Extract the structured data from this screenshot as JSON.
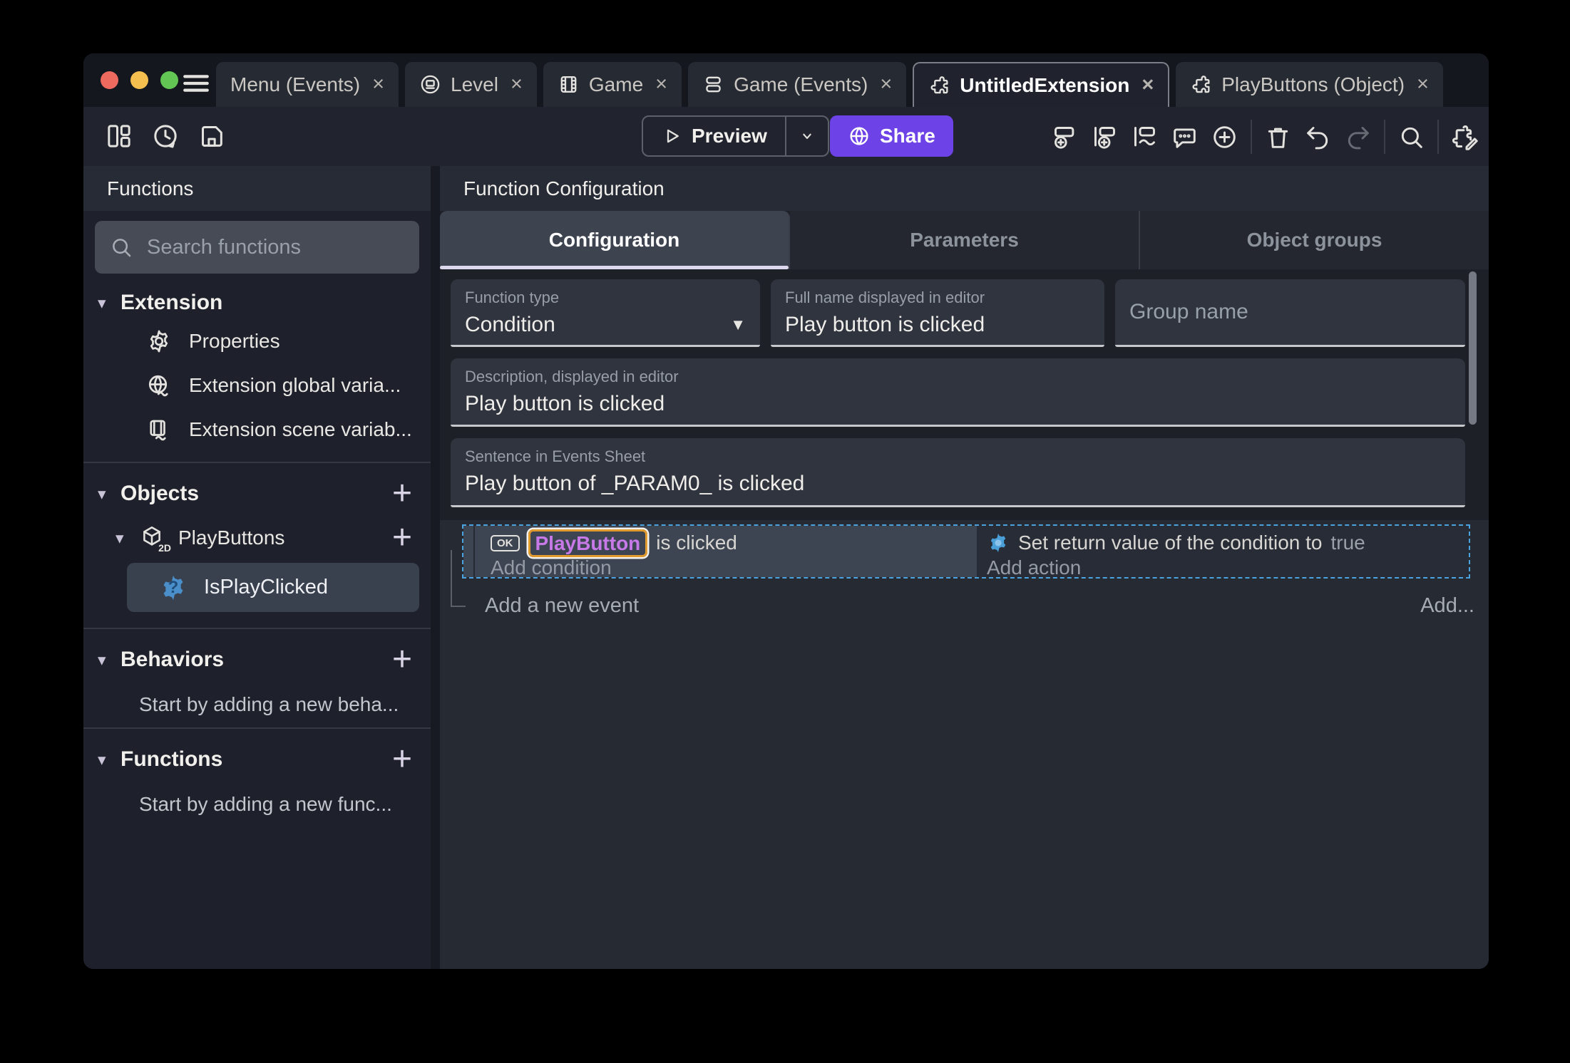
{
  "colors": {
    "accent_purple": "#6d43e8",
    "selection_blue": "#4aa3df",
    "object_text_purple": "#c879e8",
    "param_border_orange": "#e09a2d",
    "function_icon_blue": "#4b8fca",
    "traffic_red": "#ee6a5f",
    "traffic_yellow": "#f5bf4f",
    "traffic_green": "#62c554"
  },
  "tab_bar": {
    "close_glyph": "×",
    "tabs": [
      {
        "label": "Menu (Events)"
      },
      {
        "label": "Level"
      },
      {
        "label": "Game"
      },
      {
        "label": "Game (Events)"
      },
      {
        "label": "UntitledExtension"
      },
      {
        "label": "PlayButtons (Object)"
      }
    ]
  },
  "toolbar": {
    "preview_label": "Preview",
    "share_label": "Share"
  },
  "sidebar": {
    "title": "Functions",
    "search_placeholder": "Search functions",
    "extension_section": {
      "label": "Extension"
    },
    "extension_items": [
      {
        "label": "Properties"
      },
      {
        "label": "Extension global varia..."
      },
      {
        "label": "Extension scene variab..."
      }
    ],
    "objects_section": {
      "label": "Objects"
    },
    "playbuttons_item": {
      "label": "PlayButtons",
      "badge": "2D"
    },
    "selected_function": {
      "label": "IsPlayClicked",
      "glyph": "?"
    },
    "behaviors_section": {
      "label": "Behaviors",
      "empty_text": "Start by adding a new beha..."
    },
    "functions_section": {
      "label": "Functions",
      "empty_text": "Start by adding a new func..."
    }
  },
  "main": {
    "title": "Function Configuration",
    "tabs": [
      {
        "label": "Configuration"
      },
      {
        "label": "Parameters"
      },
      {
        "label": "Object groups"
      }
    ],
    "form": {
      "function_type_label": "Function type",
      "function_type_value": "Condition",
      "full_name_label": "Full name displayed in editor",
      "full_name_value": "Play button is clicked",
      "group_name_placeholder": "Group name",
      "description_label": "Description, displayed in editor",
      "description_value": "Play button is clicked",
      "sentence_label": "Sentence in Events Sheet",
      "sentence_value": "Play button of _PARAM0_ is clicked"
    },
    "events": {
      "ok_badge": "OK",
      "condition_object": "PlayButton",
      "condition_text": "is clicked",
      "add_condition": "Add condition",
      "action_text": "Set return value of the condition to",
      "action_value": "true",
      "add_action": "Add action",
      "add_new_event": "Add a new event",
      "add_button": "Add..."
    }
  },
  "glyphs": {
    "chevron_down": "▾",
    "dropdown_arrow": "▼",
    "plus": "+"
  }
}
